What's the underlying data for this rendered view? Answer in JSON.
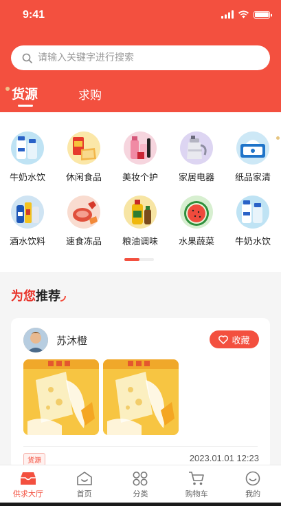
{
  "status_bar": {
    "time": "9:41"
  },
  "search": {
    "placeholder": "请输入关键字进行搜索"
  },
  "tabs": [
    {
      "label": "货源",
      "active": true
    },
    {
      "label": "求购",
      "active": false
    }
  ],
  "categories": [
    {
      "label": "牛奶水饮",
      "icon": "milk-bottles-icon"
    },
    {
      "label": "休闲食品",
      "icon": "snacks-icon"
    },
    {
      "label": "美妆个护",
      "icon": "cosmetics-icon"
    },
    {
      "label": "家居电器",
      "icon": "kettle-icon"
    },
    {
      "label": "纸品家清",
      "icon": "tissue-icon"
    },
    {
      "label": "酒水饮料",
      "icon": "drinks-icon"
    },
    {
      "label": "速食冻品",
      "icon": "frozen-food-icon"
    },
    {
      "label": "粮油调味",
      "icon": "cooking-oil-icon"
    },
    {
      "label": "水果蔬菜",
      "icon": "watermelon-icon"
    },
    {
      "label": "牛奶水饮",
      "icon": "milk-bottles-icon"
    }
  ],
  "recommend": {
    "title_highlight": "为您",
    "title_rest": "推荐"
  },
  "card": {
    "user_name": "苏沐橙",
    "favorite_label": "收藏",
    "badge": "货源",
    "timestamp": "2023.01.01  12:23"
  },
  "tabbar": [
    {
      "label": "供求大厅",
      "icon": "market-hall-icon",
      "active": true
    },
    {
      "label": "首页",
      "icon": "home-icon",
      "active": false
    },
    {
      "label": "分类",
      "icon": "category-icon",
      "active": false
    },
    {
      "label": "购物车",
      "icon": "cart-icon",
      "active": false
    },
    {
      "label": "我的",
      "icon": "profile-icon",
      "active": false
    }
  ],
  "colors": {
    "brand": "#f3503f",
    "accent_text": "#e8332a",
    "background": "#f5f5f5"
  }
}
